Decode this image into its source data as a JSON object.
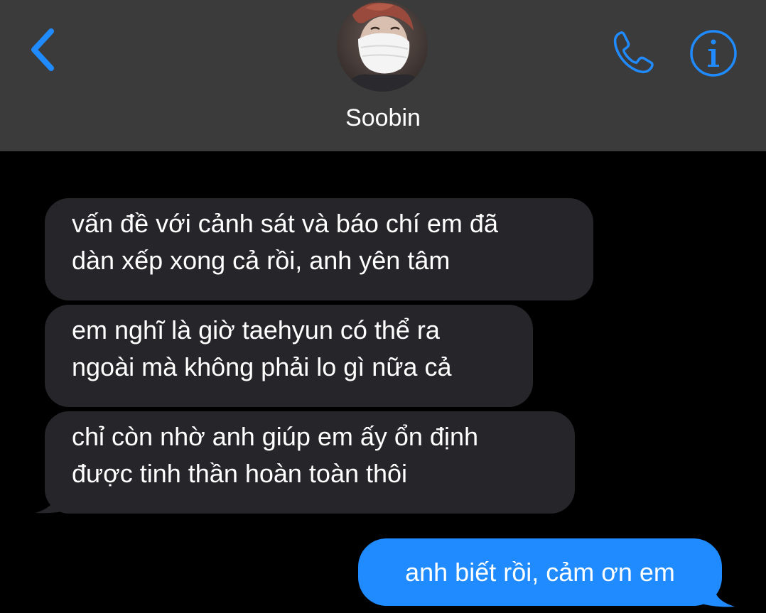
{
  "header": {
    "back_icon": "chevron-left-icon",
    "contact_name": "Soobin",
    "avatar_icon": "contact-avatar",
    "call_icon": "phone-icon",
    "info_icon": "info-icon",
    "accent_color": "#1f8bff",
    "background_color": "#3b3b3b"
  },
  "messages": [
    {
      "direction": "incoming",
      "lines": [
        "vấn đề với cảnh sát và báo chí em đã",
        "dàn xếp xong cả rồi, anh yên tâm"
      ]
    },
    {
      "direction": "incoming",
      "lines": [
        "em nghĩ là giờ taehyun có thể ra",
        "ngoài mà không phải lo gì nữa cả"
      ]
    },
    {
      "direction": "incoming",
      "lines": [
        "chỉ còn nhờ anh giúp em ấy ổn định",
        "được tinh thần hoàn toàn thôi"
      ]
    },
    {
      "direction": "outgoing",
      "text": "anh biết rồi, cảm ơn em"
    }
  ],
  "colors": {
    "incoming_bubble": "#262529",
    "outgoing_bubble": "#1f8bff",
    "chat_background": "#000000"
  }
}
